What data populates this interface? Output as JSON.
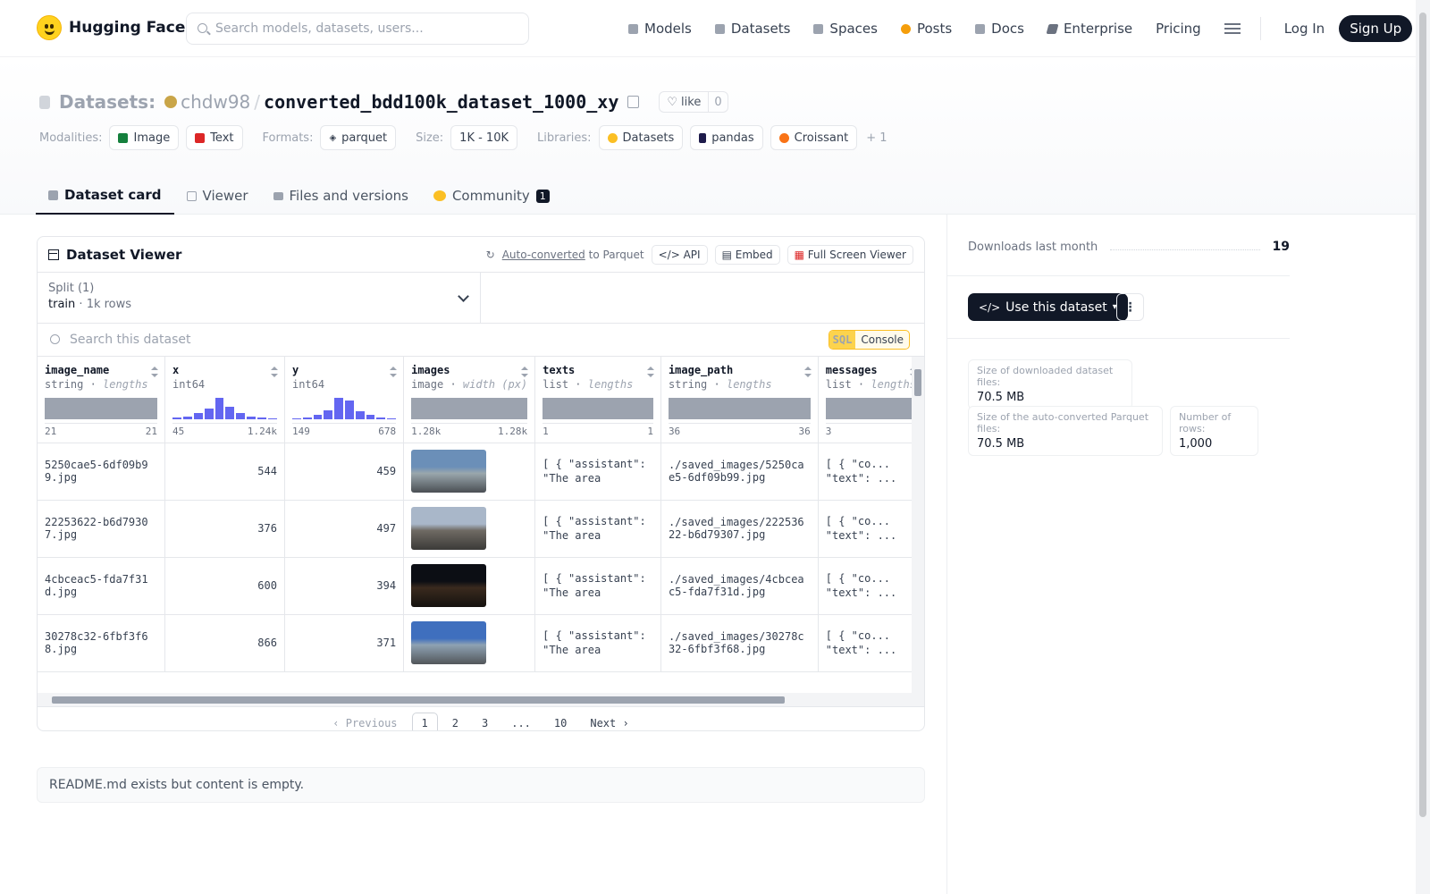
{
  "header": {
    "brand": "Hugging Face",
    "search_placeholder": "Search models, datasets, users...",
    "nav": [
      {
        "label": "Models",
        "icon": "models-icon",
        "color": "#9ca3af"
      },
      {
        "label": "Datasets",
        "icon": "datasets-icon",
        "color": "#b0b6c0"
      },
      {
        "label": "Spaces",
        "icon": "spaces-icon",
        "color": "#a3a8b3"
      },
      {
        "label": "Posts",
        "icon": "posts-icon",
        "color": "#f59e0b"
      },
      {
        "label": "Docs",
        "icon": "docs-icon",
        "color": "#b0b6c0"
      },
      {
        "label": "Enterprise",
        "icon": "enterprise-icon",
        "color": "#6b7280"
      },
      {
        "label": "Pricing",
        "icon": "",
        "color": ""
      }
    ],
    "login": "Log In",
    "signup": "Sign Up"
  },
  "repo": {
    "type_label": "Datasets:",
    "owner": "chdw98",
    "name": "converted_bdd100k_dataset_1000_xy",
    "like_label": "like",
    "like_count": "0",
    "modalities_label": "Modalities:",
    "modalities": [
      "Image",
      "Text"
    ],
    "formats_label": "Formats:",
    "formats": [
      "parquet"
    ],
    "size_label": "Size:",
    "size": "1K - 10K",
    "libraries_label": "Libraries:",
    "libraries": [
      "Datasets",
      "pandas",
      "Croissant"
    ],
    "more": "+ 1"
  },
  "tabs": [
    {
      "label": "Dataset card",
      "active": true
    },
    {
      "label": "Viewer",
      "active": false
    },
    {
      "label": "Files and versions",
      "active": false
    },
    {
      "label": "Community",
      "active": false,
      "badge": "1"
    }
  ],
  "viewer": {
    "title": "Dataset Viewer",
    "auto_converted": "Auto-converted",
    "to_parquet": "to Parquet",
    "api": "API",
    "embed": "Embed",
    "full_screen": "Full Screen Viewer",
    "split_label": "Split (1)",
    "split_name": "train",
    "split_rows": "1k rows",
    "search_placeholder": "Search this dataset",
    "sql_tag": "SQL",
    "console": "Console",
    "columns": [
      {
        "name": "image_name",
        "type": "string",
        "stat": "lengths",
        "min": "21",
        "max": "21",
        "viz": "bar"
      },
      {
        "name": "x",
        "type": "int64",
        "stat": "",
        "min": "45",
        "max": "1.24k",
        "viz": "hist",
        "hist": [
          0.08,
          0.14,
          0.3,
          0.48,
          1.0,
          0.58,
          0.28,
          0.14,
          0.08,
          0.06
        ]
      },
      {
        "name": "y",
        "type": "int64",
        "stat": "",
        "min": "149",
        "max": "678",
        "viz": "hist",
        "hist": [
          0.06,
          0.1,
          0.22,
          0.42,
          1.0,
          0.86,
          0.36,
          0.2,
          0.08,
          0.06
        ]
      },
      {
        "name": "images",
        "type": "image",
        "stat": "width (px)",
        "min": "1.28k",
        "max": "1.28k",
        "viz": "bar"
      },
      {
        "name": "texts",
        "type": "list",
        "stat": "lengths",
        "min": "1",
        "max": "1",
        "viz": "bar"
      },
      {
        "name": "image_path",
        "type": "string",
        "stat": "lengths",
        "min": "36",
        "max": "36",
        "viz": "bar"
      },
      {
        "name": "messages",
        "type": "list",
        "stat": "lengths",
        "min": "3",
        "max": "",
        "viz": "bar"
      }
    ],
    "rows": [
      {
        "image_name": "5250cae5-6df09b99.jpg",
        "x": "544",
        "y": "459",
        "texts": "[ { \"assistant\": \"The area around...",
        "image_path": "./saved_images/5250cae5-6df09b99.jpg",
        "messages": "[ { \"co... \"text\": ...",
        "thumb": [
          "#6b8fb8",
          "#9aa7ad",
          "#4a4f54"
        ]
      },
      {
        "image_name": "22253622-b6d79307.jpg",
        "x": "376",
        "y": "497",
        "texts": "[ { \"assistant\": \"The area around...",
        "image_path": "./saved_images/22253622-b6d79307.jpg",
        "messages": "[ { \"co... \"text\": ...",
        "thumb": [
          "#a9b7c9",
          "#6f6a63",
          "#3b3a38"
        ]
      },
      {
        "image_name": "4cbceac5-fda7f31d.jpg",
        "x": "600",
        "y": "394",
        "texts": "[ { \"assistant\": \"The area around...",
        "image_path": "./saved_images/4cbceac5-fda7f31d.jpg",
        "messages": "[ { \"co... \"text\": ...",
        "thumb": [
          "#0c0e14",
          "#3a2a1e",
          "#15120f"
        ]
      },
      {
        "image_name": "30278c32-6fbf3f68.jpg",
        "x": "866",
        "y": "371",
        "texts": "[ { \"assistant\": \"The area around...",
        "image_path": "./saved_images/30278c32-6fbf3f68.jpg",
        "messages": "[ { \"co... \"text\": ...",
        "thumb": [
          "#3f6fbe",
          "#8ea2b3",
          "#52565a"
        ]
      }
    ],
    "pager": {
      "prev": "Previous",
      "pages": [
        "1",
        "2",
        "3",
        "...",
        "10"
      ],
      "current": "1",
      "next": "Next"
    }
  },
  "readme": "README.md exists but content is empty.",
  "sidebar": {
    "downloads_label": "Downloads last month",
    "downloads": "19",
    "use_button": "Use this dataset",
    "stats": [
      {
        "label": "Size of downloaded dataset files:",
        "value": "70.5 MB"
      },
      {
        "label": "Size of the auto-converted Parquet files:",
        "value": "70.5 MB"
      },
      {
        "label": "Number of rows:",
        "value": "1,000"
      }
    ]
  }
}
